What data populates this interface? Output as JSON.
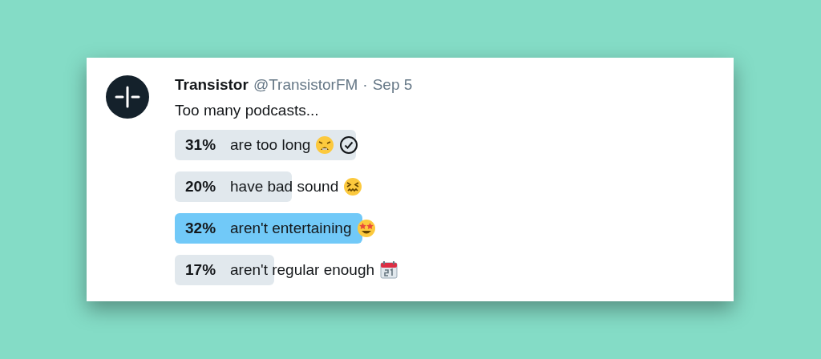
{
  "tweet": {
    "name": "Transistor",
    "handle": "@TransistorFM",
    "separator": "·",
    "date": "Sep 5",
    "text": "Too many podcasts...",
    "poll": [
      {
        "percent": "31%",
        "label": "are too long",
        "kind": "tired",
        "level": 0.31,
        "voted": true,
        "winning": false
      },
      {
        "percent": "20%",
        "label": "have bad sound",
        "kind": "confounded",
        "level": 0.2,
        "voted": false,
        "winning": false
      },
      {
        "percent": "32%",
        "label": "aren't entertaining",
        "kind": "starstruck",
        "level": 0.32,
        "voted": false,
        "winning": true
      },
      {
        "percent": "17%",
        "label": "aren't regular enough",
        "kind": "calendar",
        "level": 0.17,
        "voted": false,
        "winning": false
      }
    ]
  }
}
